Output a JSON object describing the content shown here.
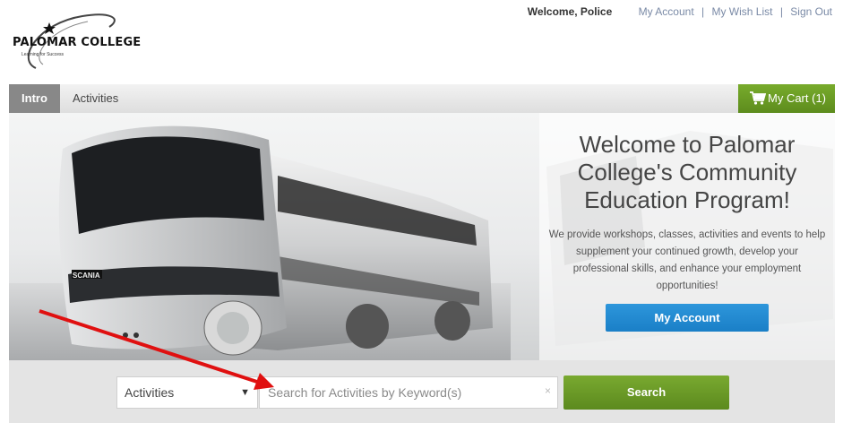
{
  "logo": {
    "name": "PALOMAR COLLEGE",
    "tagline": "Learning for Success"
  },
  "header": {
    "welcome": "Welcome, Police",
    "links": [
      "My Account",
      "My Wish List",
      "Sign Out"
    ],
    "separator": "|"
  },
  "nav": {
    "tabs": [
      "Intro",
      "Activities"
    ],
    "active_tab": "Intro",
    "cart_label": "My Cart (1)"
  },
  "hero": {
    "title": "Welcome to Palomar College's Community Education Program!",
    "description": "We provide workshops, classes, activities and events to help supplement your continued growth, develop your professional skills, and enhance your employment opportunities!",
    "button_label": "My Account",
    "truck_badge": "SCANIA"
  },
  "search": {
    "category_value": "Activities",
    "placeholder": "Search for Activities by Keyword(s)",
    "clear_glyph": "×",
    "button_label": "Search"
  },
  "colors": {
    "accent_green": "#6b9a24",
    "accent_blue": "#2289d1",
    "annotation_red": "#e01010"
  }
}
